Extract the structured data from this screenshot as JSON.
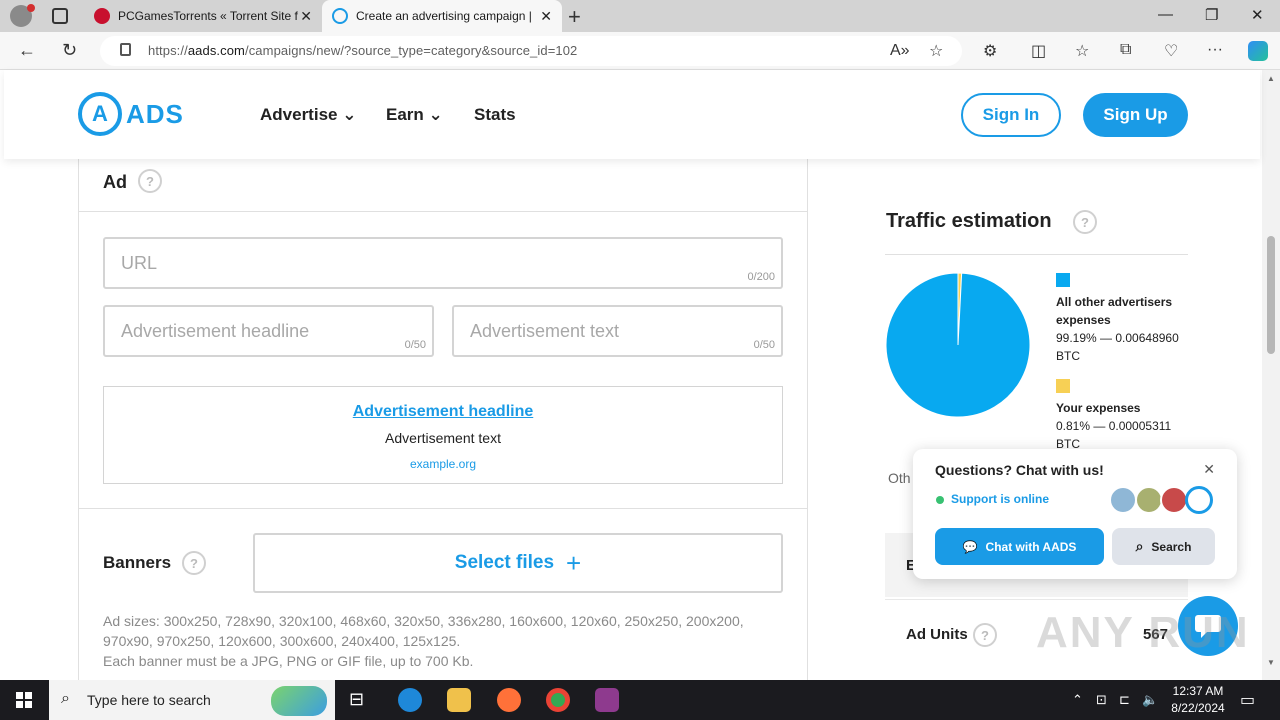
{
  "browser": {
    "tabs": [
      {
        "label": "PCGamesTorrents « Torrent Site f",
        "active": false
      },
      {
        "label": "Create an advertising campaign |",
        "active": true
      }
    ],
    "address_prefix": "https://",
    "address_domain": "aads.com",
    "address_path": "/campaigns/new/?source_type=category&source_id=102"
  },
  "header": {
    "logo_letter": "A",
    "logo_text": "ADS",
    "menu": [
      "Advertise",
      "Earn",
      "Stats"
    ],
    "sign_in": "Sign In",
    "sign_up": "Sign Up"
  },
  "ad_section": {
    "title": "Ad",
    "help": "?",
    "url_placeholder": "URL",
    "url_counter": "0/200",
    "headline_placeholder": "Advertisement headline",
    "headline_counter": "0/50",
    "text_placeholder": "Advertisement text",
    "text_counter": "0/50",
    "preview": {
      "headline": "Advertisement headline",
      "text": "Advertisement text",
      "url": "example.org"
    }
  },
  "banners": {
    "title": "Banners",
    "select_files": "Select files",
    "sizes_text": "Ad sizes: 300x250, 728x90, 320x100, 468x60, 320x50, 336x280, 160x600, 120x60, 250x250, 200x200, 970x90, 970x250, 120x600, 300x600, 240x400, 125x125.",
    "format_text": "Each banner must be a JPG, PNG or GIF file, up to 700 Kb."
  },
  "traffic": {
    "title": "Traffic estimation",
    "legend": [
      {
        "label": "All other advertisers expenses",
        "value": "99.19% — 0.00648960 BTC",
        "color": "#08a9f0"
      },
      {
        "label": "Your expenses",
        "value": "0.81% — 0.00005311 BTC",
        "color": "#f7d055"
      }
    ],
    "other_label": "Oth",
    "row_partial_label": "E",
    "ad_units_label": "Ad Units",
    "ad_units_value": "567"
  },
  "chart_data": {
    "type": "pie",
    "categories": [
      "All other advertisers expenses",
      "Your expenses"
    ],
    "values": [
      99.19,
      0.81
    ],
    "colors": [
      "#08a9f0",
      "#f7d055"
    ]
  },
  "chat": {
    "question": "Questions? Chat with us!",
    "status": "Support is online",
    "chat_button": "Chat with AADS",
    "search_button": "Search"
  },
  "watermark": "ANY RUN",
  "taskbar": {
    "search_placeholder": "Type here to search",
    "time": "12:37 AM",
    "date": "8/22/2024"
  },
  "colors": {
    "brand": "#1a9be6",
    "pie_main": "#08a9f0",
    "pie_small": "#f7d055"
  }
}
